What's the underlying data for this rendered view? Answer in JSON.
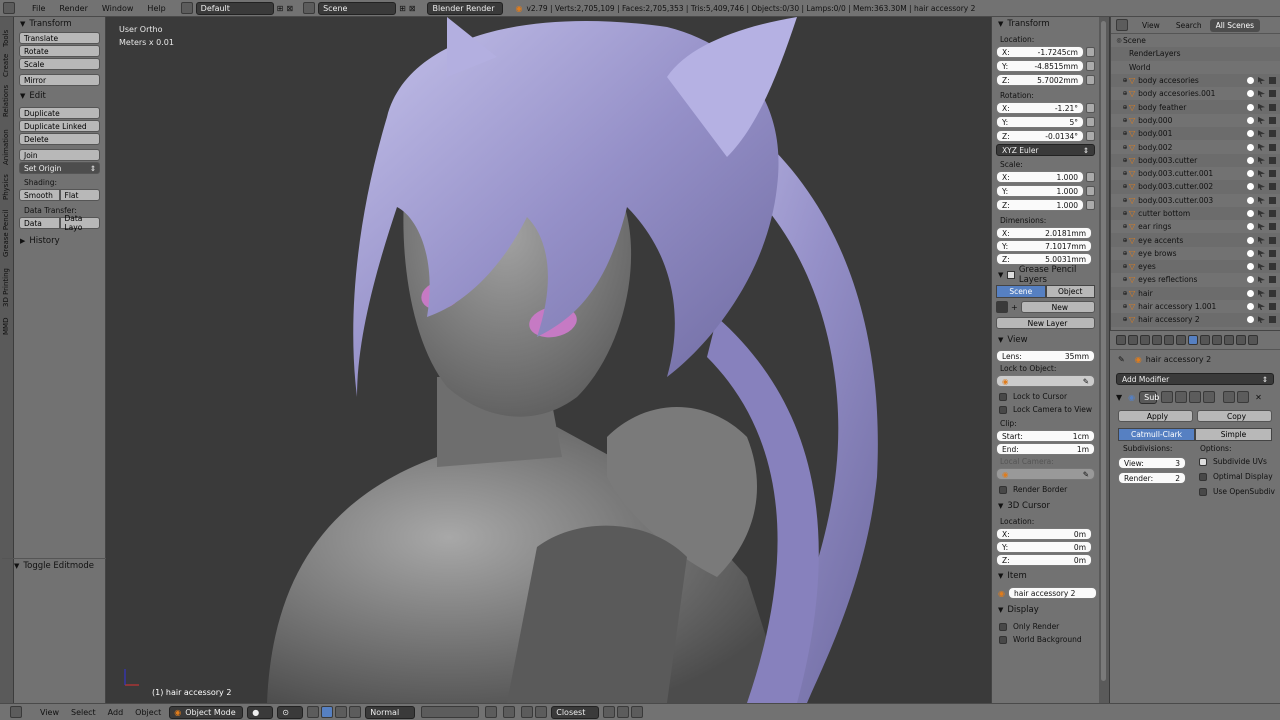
{
  "topbar": {
    "menus": [
      "File",
      "Render",
      "Window",
      "Help"
    ],
    "layout": "Default",
    "scene": "Scene",
    "engine": "Blender Render",
    "stats": "v2.79 | Verts:2,705,109 | Faces:2,705,353 | Tris:5,409,746 | Objects:0/30 | Lamps:0/0 | Mem:363.30M | hair accessory 2"
  },
  "lefttabs": [
    "Tools",
    "Create",
    "Relations",
    "Animation",
    "Physics",
    "Grease Pencil",
    "3D Printing",
    "MMD"
  ],
  "toolshelf": {
    "transform_header": "Transform",
    "translate": "Translate",
    "rotate": "Rotate",
    "scale": "Scale",
    "mirror": "Mirror",
    "edit_header": "Edit",
    "duplicate": "Duplicate",
    "duplicate_linked": "Duplicate Linked",
    "delete": "Delete",
    "join": "Join",
    "set_origin": "Set Origin",
    "shading_label": "Shading:",
    "smooth": "Smooth",
    "flat": "Flat",
    "data_transfer_label": "Data Transfer:",
    "data": "Data",
    "data_layout": "Data Layo",
    "history": "History",
    "toggle_editmode": "Toggle Editmode"
  },
  "viewport": {
    "view_name": "User Ortho",
    "units": "Meters x 0.01",
    "selection": "(1) hair accessory 2"
  },
  "nprops": {
    "transform_header": "Transform",
    "location_label": "Location:",
    "loc_x": "-1.7245cm",
    "loc_y": "-4.8515mm",
    "loc_z": "5.7002mm",
    "rotation_label": "Rotation:",
    "rot_x": "-1.21°",
    "rot_y": "5°",
    "rot_z": "-0.0134°",
    "rotation_mode": "XYZ Euler",
    "scale_label": "Scale:",
    "scale_x": "1.000",
    "scale_y": "1.000",
    "scale_z": "1.000",
    "dimensions_label": "Dimensions:",
    "dim_x": "2.0181mm",
    "dim_y": "7.1017mm",
    "dim_z": "5.0031mm",
    "grease_header": "Grease Pencil Layers",
    "scene_tab": "Scene",
    "object_tab": "Object",
    "new_btn": "New",
    "new_layer": "New Layer",
    "view_header": "View",
    "lens_label": "Lens:",
    "lens_value": "35mm",
    "lock_to_object": "Lock to Object:",
    "lock_to_cursor": "Lock to Cursor",
    "lock_camera": "Lock Camera to View",
    "clip_label": "Clip:",
    "clip_start_label": "Start:",
    "clip_start": "1cm",
    "clip_end_label": "End:",
    "clip_end": "1m",
    "local_camera": "Local Camera:",
    "render_border": "Render Border",
    "cursor_header": "3D Cursor",
    "cursor_location": "Location:",
    "cur_x": "0m",
    "cur_y": "0m",
    "cur_z": "0m",
    "item_header": "Item",
    "item_name": "hair accessory 2",
    "display_header": "Display",
    "only_render": "Only Render",
    "world_background": "World Background",
    "x": "X:",
    "y": "Y:",
    "z": "Z:"
  },
  "outliner": {
    "view": "View",
    "search": "Search",
    "all_scenes": "All Scenes",
    "items": [
      "Scene",
      "RenderLayers",
      "World",
      "body accesories",
      "body accesories.001",
      "body feather",
      "body.000",
      "body.001",
      "body.002",
      "body.003.cutter",
      "body.003.cutter.001",
      "body.003.cutter.002",
      "body.003.cutter.003",
      "cutter bottom",
      "ear rings",
      "eye accents",
      "eye brows",
      "eyes",
      "eyes reflections",
      "hair",
      "hair accessory 1.001",
      "hair accessory 2"
    ]
  },
  "props": {
    "object_name": "hair accessory 2",
    "add_modifier": "Add Modifier",
    "modifier_name": "Sub",
    "apply": "Apply",
    "copy": "Copy",
    "catmull": "Catmull-Clark",
    "simple": "Simple",
    "subdivisions_label": "Subdivisions:",
    "options_label": "Options:",
    "view_label": "View:",
    "view_value": "3",
    "render_label": "Render:",
    "render_value": "2",
    "subdivide_uvs": "Subdivide UVs",
    "optimal_display": "Optimal Display",
    "use_opensubdiv": "Use OpenSubdiv"
  },
  "bottombar": {
    "menus": [
      "View",
      "Select",
      "Add",
      "Object"
    ],
    "mode": "Object Mode",
    "pivot": "Normal",
    "snap": "Closest"
  }
}
